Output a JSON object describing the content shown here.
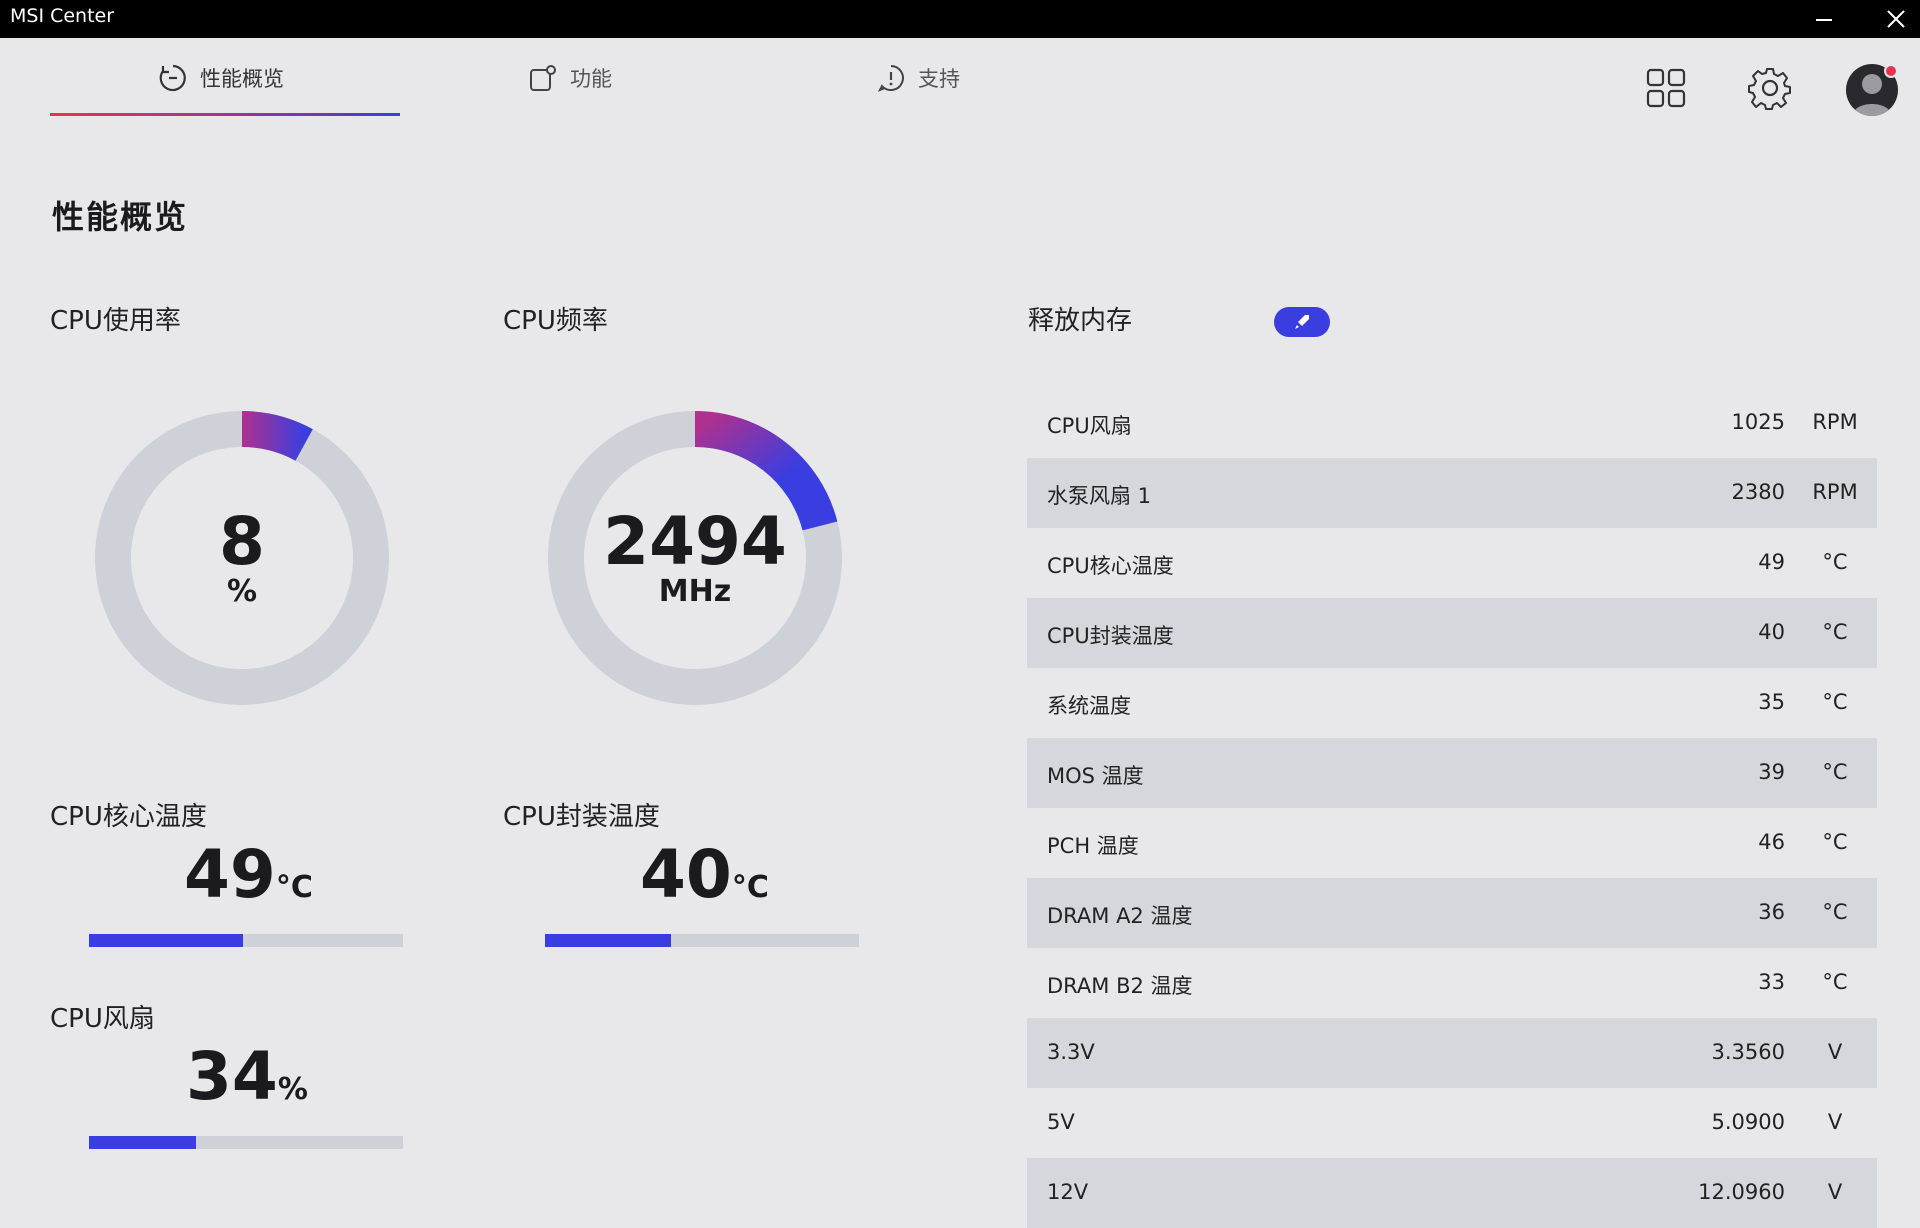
{
  "window": {
    "title": "MSI Center"
  },
  "tabs": [
    {
      "label": "性能概览",
      "icon": "gauge-icon"
    },
    {
      "label": "功能",
      "icon": "feature-icon"
    },
    {
      "label": "支持",
      "icon": "support-icon"
    }
  ],
  "header_icons": [
    "grid-icon",
    "gear-icon",
    "avatar"
  ],
  "page": {
    "title": "性能概览"
  },
  "cpu_usage": {
    "label": "CPU使用率",
    "value": "8",
    "unit": "%",
    "fraction": 0.08
  },
  "cpu_freq": {
    "label": "CPU频率",
    "value": "2494",
    "unit": "MHz",
    "fraction": 0.21
  },
  "cpu_core_temp": {
    "label": "CPU核心温度",
    "value": "49",
    "unit": "°C",
    "fraction": 0.49
  },
  "cpu_package_temp": {
    "label": "CPU封装温度",
    "value": "40",
    "unit": "°C",
    "fraction": 0.4
  },
  "cpu_fan": {
    "label": "CPU风扇",
    "value": "34",
    "unit": "%",
    "fraction": 0.34
  },
  "release_memory": {
    "label": "释放内存"
  },
  "sensors": [
    {
      "name": "CPU风扇",
      "value": "1025",
      "unit": "RPM"
    },
    {
      "name": "水泵风扇 1",
      "value": "2380",
      "unit": "RPM"
    },
    {
      "name": "CPU核心温度",
      "value": "49",
      "unit": "°C"
    },
    {
      "name": "CPU封装温度",
      "value": "40",
      "unit": "°C"
    },
    {
      "name": "系统温度",
      "value": "35",
      "unit": "°C"
    },
    {
      "name": "MOS 温度",
      "value": "39",
      "unit": "°C"
    },
    {
      "name": "PCH 温度",
      "value": "46",
      "unit": "°C"
    },
    {
      "name": "DRAM A2 温度",
      "value": "36",
      "unit": "°C"
    },
    {
      "name": "DRAM B2 温度",
      "value": "33",
      "unit": "°C"
    },
    {
      "name": "3.3V",
      "value": "3.3560",
      "unit": "V"
    },
    {
      "name": "5V",
      "value": "5.0900",
      "unit": "V"
    },
    {
      "name": "12V",
      "value": "12.0960",
      "unit": "V"
    }
  ],
  "colors": {
    "accent": "#3a3ee0",
    "accent_start": "#b0308e",
    "track": "#cfd1d8",
    "background": "#e8e8eb",
    "alert": "#e8344f"
  }
}
